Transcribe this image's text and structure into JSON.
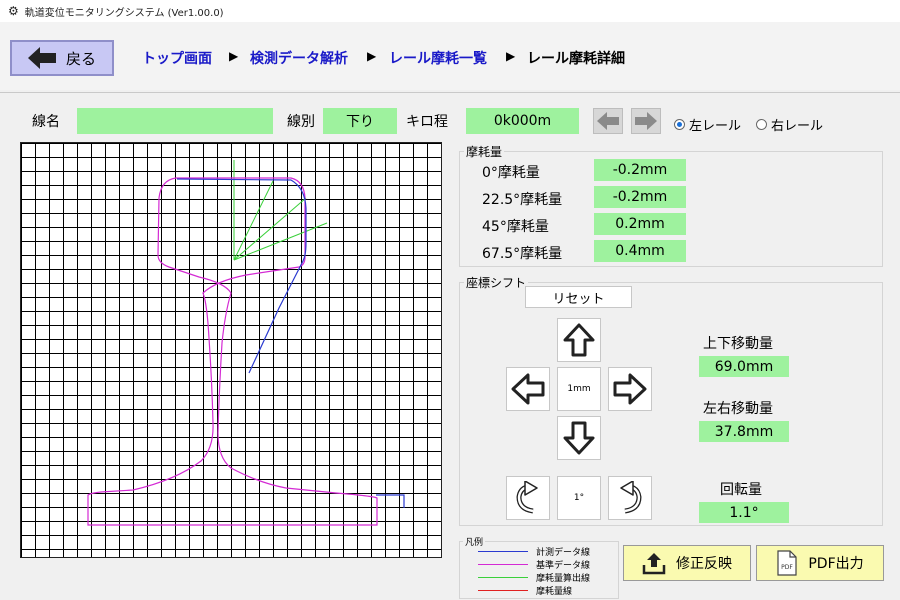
{
  "window": {
    "title": "軌道変位モニタリングシステム (Ver1.00.0)"
  },
  "header": {
    "back_label": "戻る",
    "breadcrumb": [
      "トップ画面",
      "検測データ解析",
      "レール摩耗一覧",
      "レール摩耗詳細"
    ]
  },
  "info": {
    "line_name_label": "線名",
    "line_name_value": "",
    "direction_label": "線別",
    "direction_value": "下り",
    "km_label": "キロ程",
    "km_value": "0k000m",
    "rail_left": "左レール",
    "rail_right": "右レール",
    "rail_selected": "left"
  },
  "wear": {
    "title": "摩耗量",
    "items": [
      {
        "label": "0°摩耗量",
        "value": "-0.2mm"
      },
      {
        "label": "22.5°摩耗量",
        "value": "-0.2mm"
      },
      {
        "label": "45°摩耗量",
        "value": "0.2mm"
      },
      {
        "label": "67.5°摩耗量",
        "value": "0.4mm"
      }
    ]
  },
  "shift": {
    "title": "座標シフト",
    "reset_label": "リセット",
    "step_label": "1mm",
    "rot_step_label": "1°",
    "vertical_label": "上下移動量",
    "vertical_value": "69.0mm",
    "horizontal_label": "左右移動量",
    "horizontal_value": "37.8mm",
    "rotation_label": "回転量",
    "rotation_value": "1.1°"
  },
  "legend": {
    "title": "凡例",
    "items": [
      {
        "label": "計測データ線",
        "color": "#2a3ad0"
      },
      {
        "label": "基準データ線",
        "color": "#d42ad4"
      },
      {
        "label": "摩耗量算出線",
        "color": "#3ad03a"
      },
      {
        "label": "摩耗量線",
        "color": "#e02020"
      }
    ]
  },
  "actions": {
    "apply_label": "修正反映",
    "pdf_label": "PDF出力",
    "pdf_icon_text": "PDF"
  },
  "colors": {
    "accent": "#1a1ac8",
    "value_bg": "#9ef29e",
    "button_yellow": "#fafab0"
  }
}
